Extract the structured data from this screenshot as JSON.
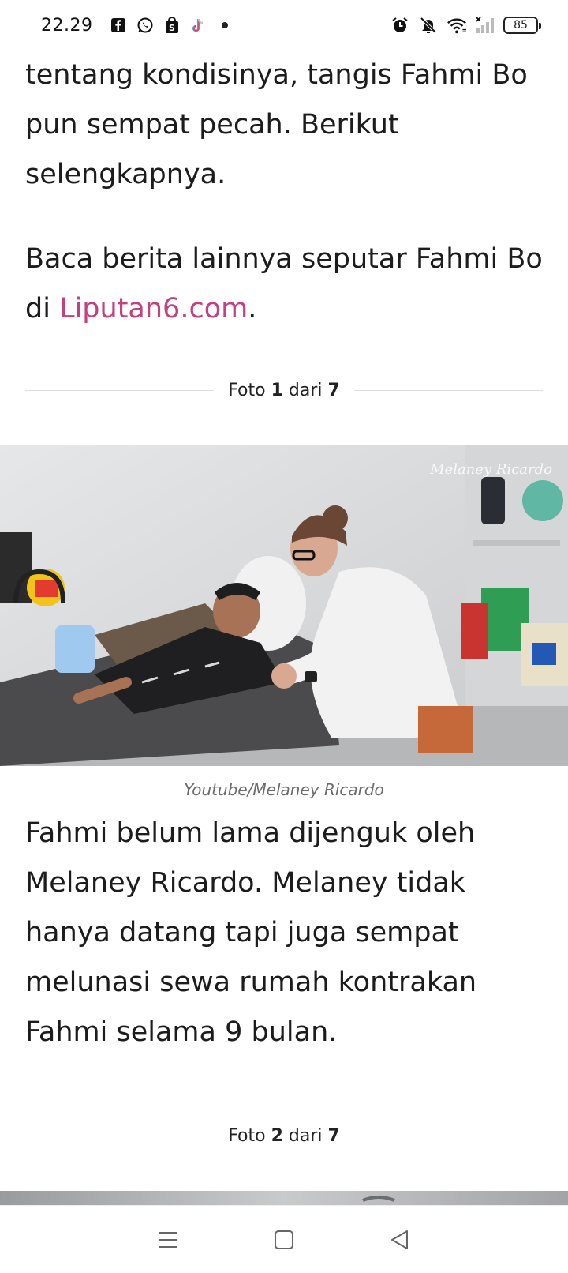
{
  "status_bar": {
    "time": "22.29",
    "notification_icons": [
      "facebook-icon",
      "whatsapp-icon",
      "shopping-bag-icon",
      "tiktok-icon"
    ],
    "system_icons": [
      "alarm-icon",
      "mute-icon",
      "wifi-icon",
      "signal-icon"
    ],
    "battery_level": "85"
  },
  "article": {
    "paragraph_1": "tentang kondisinya, tangis Fahmi Bo pun sempat pecah. Berikut selengkapnya.",
    "paragraph_2_prefix": "Baca berita lainnya seputar Fahmi Bo di ",
    "paragraph_2_link": "Liputan6.com",
    "paragraph_2_suffix": ".",
    "photo_1": {
      "label_prefix": "Foto ",
      "index": "1",
      "label_mid": " dari ",
      "total": "7",
      "watermark": "Melaney Ricardo",
      "caption": "Youtube/Melaney Ricardo"
    },
    "paragraph_3": "Fahmi belum lama dijenguk oleh Melaney Ricardo. Melaney tidak hanya datang tapi juga sempat melunasi sewa rumah kontrakan Fahmi selama 9 bulan.",
    "photo_2": {
      "label_prefix": "Foto ",
      "index": "2",
      "label_mid": " dari ",
      "total": "7"
    }
  },
  "nav_bar": {
    "buttons": [
      "menu-icon",
      "home-icon",
      "back-icon"
    ]
  },
  "colors": {
    "link": "#c2417e",
    "text": "#1c1c1c",
    "caption": "#6b6b6b",
    "divider": "#dedede"
  }
}
